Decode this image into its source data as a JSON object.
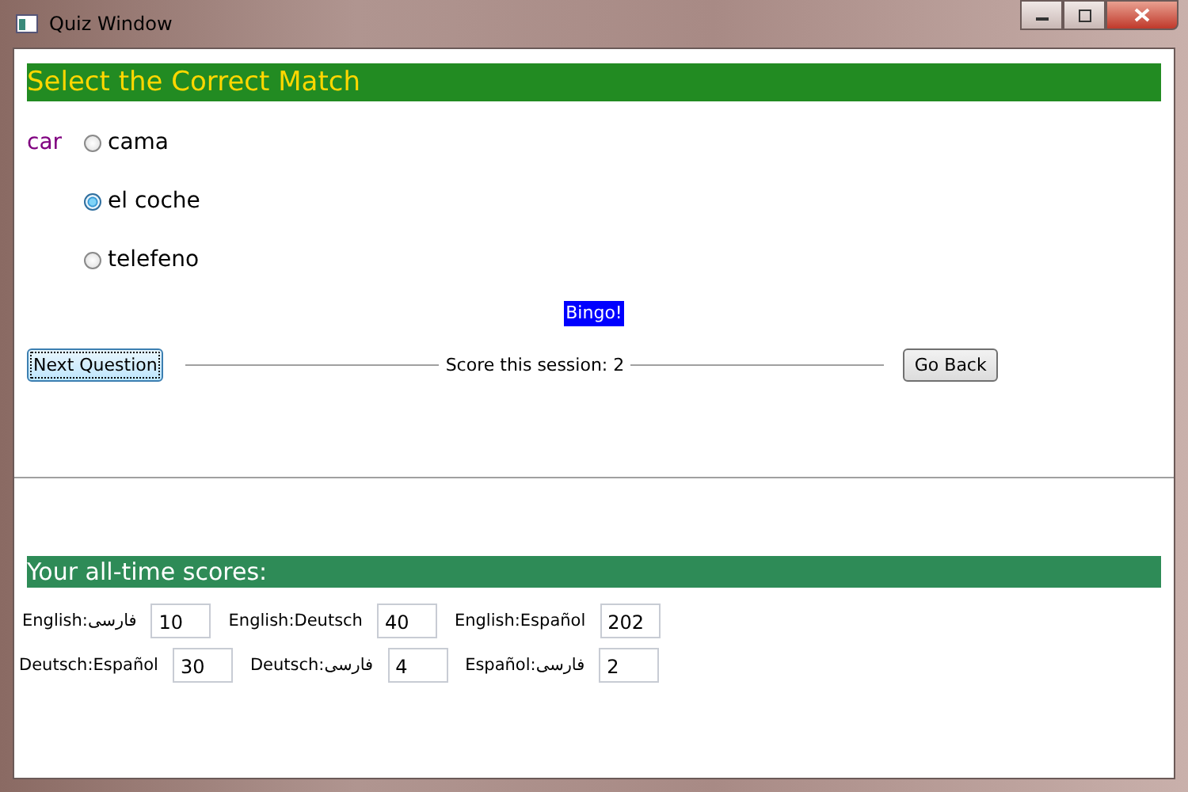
{
  "window": {
    "title": "Quiz Window"
  },
  "question": {
    "title": "Select the Correct Match",
    "word": "car",
    "options": [
      {
        "label": "cama",
        "selected": false
      },
      {
        "label": "el coche",
        "selected": true
      },
      {
        "label": "telefeno",
        "selected": false
      }
    ],
    "feedback": "Bingo!"
  },
  "actions": {
    "next": "Next Question",
    "score": "Score this session: 2",
    "back": "Go Back"
  },
  "all_time": {
    "title": "Your all-time scores:",
    "rows": [
      [
        {
          "label": "English:فارسی",
          "value": "10"
        },
        {
          "label": "English:Deutsch",
          "value": "40"
        },
        {
          "label": "English:Español",
          "value": "202"
        }
      ],
      [
        {
          "label": "Deutsch:Español",
          "value": "30"
        },
        {
          "label": "Deutsch:فارسی",
          "value": "4"
        },
        {
          "label": "Español:فارسی",
          "value": "2"
        }
      ]
    ]
  }
}
